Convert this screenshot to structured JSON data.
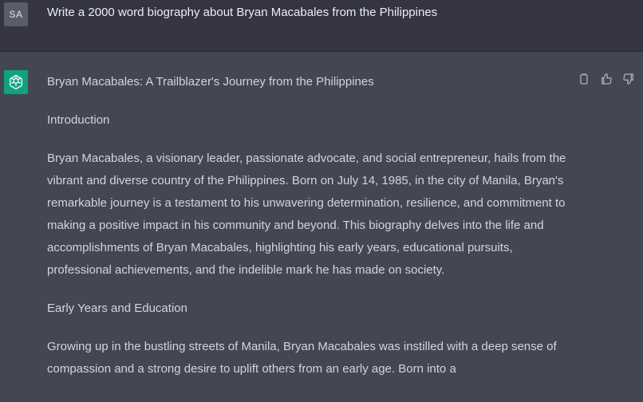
{
  "user": {
    "avatar_initials": "SA",
    "message": "Write a 2000 word biography about Bryan Macabales from the Philippines"
  },
  "assistant": {
    "avatar_icon": "openai-logo-icon",
    "title": "Bryan Macabales: A Trailblazer's Journey from the Philippines",
    "intro_heading": "Introduction",
    "intro_text": "Bryan Macabales, a visionary leader, passionate advocate, and social entrepreneur, hails from the vibrant and diverse country of the Philippines. Born on July 14, 1985, in the city of Manila, Bryan's remarkable journey is a testament to his unwavering determination, resilience, and commitment to making a positive impact in his community and beyond. This biography delves into the life and accomplishments of Bryan Macabales, highlighting his early years, educational pursuits, professional achievements, and the indelible mark he has made on society.",
    "section2_heading": "Early Years and Education",
    "section2_text": "Growing up in the bustling streets of Manila, Bryan Macabales was instilled with a deep sense of compassion and a strong desire to uplift others from an early age. Born into a"
  },
  "actions": {
    "copy_icon": "clipboard-icon",
    "thumbs_up_icon": "thumbs-up-icon",
    "thumbs_down_icon": "thumbs-down-icon"
  },
  "colors": {
    "user_bg": "#343541",
    "assistant_bg": "#444654",
    "avatar_green": "#10a37f",
    "text": "#d1d5db"
  }
}
